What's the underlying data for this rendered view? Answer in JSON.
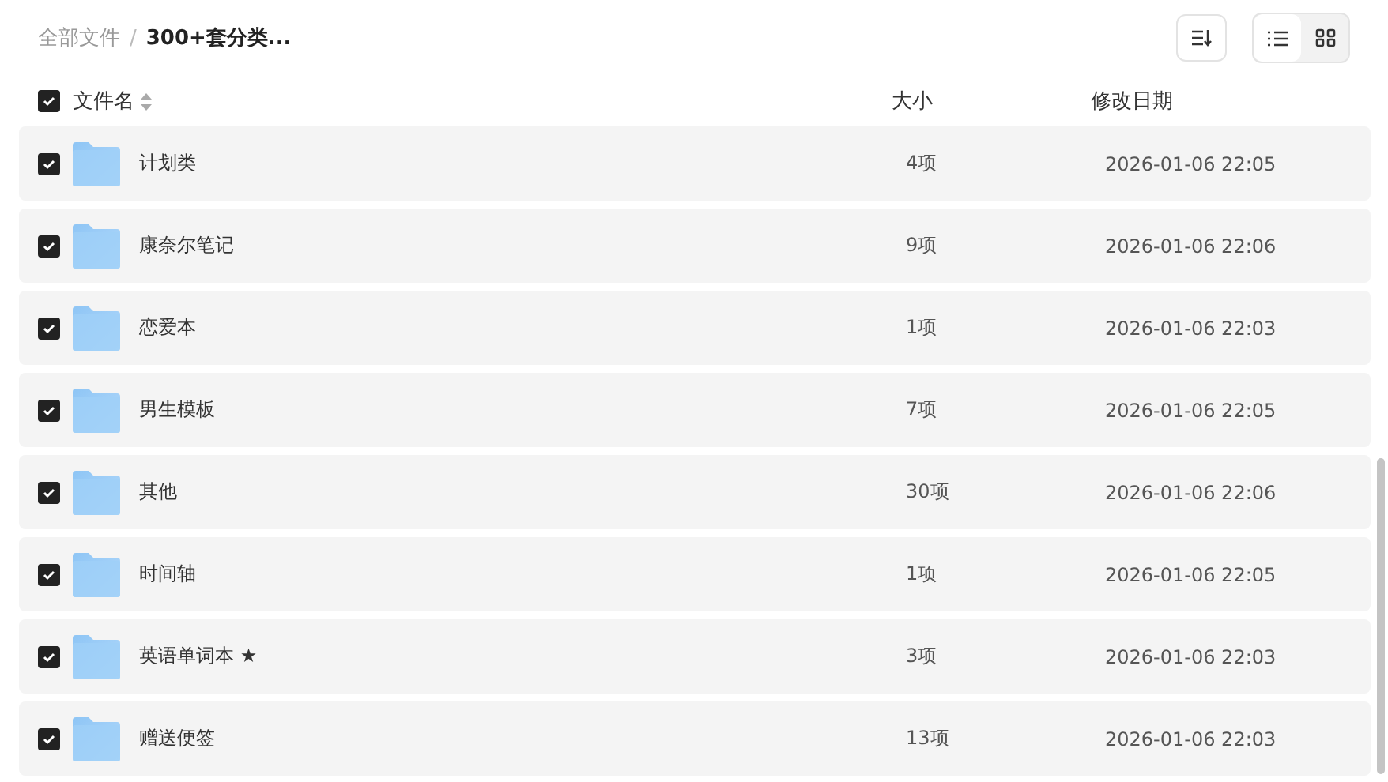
{
  "breadcrumb_separator": "/",
  "breadcrumb": [
    {
      "label": "全部文件",
      "current": false
    },
    {
      "label": "300+套分类...",
      "current": true
    }
  ],
  "view_modes": [
    {
      "kind": "list",
      "selected": true
    },
    {
      "kind": "grid",
      "selected": false
    }
  ],
  "table": {
    "select_all_checked": true,
    "columns": [
      {
        "label": "文件名",
        "sortable": true
      },
      {
        "label": "大小",
        "sortable": false
      },
      {
        "label": "修改日期",
        "sortable": false
      }
    ],
    "rows": [
      {
        "name": "计划类",
        "size": "4项",
        "modified": "2026-01-06 22:05",
        "checked": true
      },
      {
        "name": "康奈尔笔记",
        "size": "9项",
        "modified": "2026-01-06 22:06",
        "checked": true
      },
      {
        "name": "恋爱本",
        "size": "1项",
        "modified": "2026-01-06 22:03",
        "checked": true
      },
      {
        "name": "男生模板",
        "size": "7项",
        "modified": "2026-01-06 22:05",
        "checked": true
      },
      {
        "name": "其他",
        "size": "30项",
        "modified": "2026-01-06 22:06",
        "checked": true
      },
      {
        "name": "时间轴",
        "size": "1项",
        "modified": "2026-01-06 22:05",
        "checked": true
      },
      {
        "name": "英语单词本 ★",
        "size": "3项",
        "modified": "2026-01-06 22:03",
        "checked": true
      },
      {
        "name": "赠送便签",
        "size": "13项",
        "modified": "2026-01-06 22:03",
        "checked": true
      }
    ]
  }
}
